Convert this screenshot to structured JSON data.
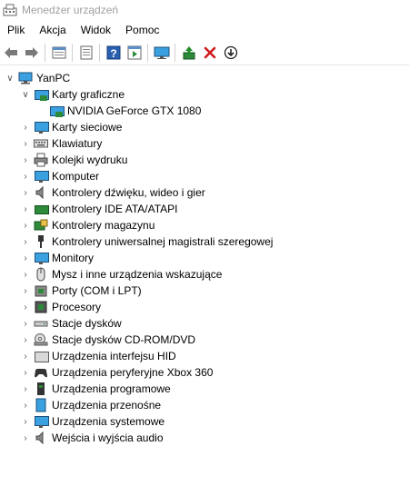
{
  "window": {
    "title": "Menedżer urządzeń"
  },
  "menu": {
    "items": [
      "Plik",
      "Akcja",
      "Widok",
      "Pomoc"
    ]
  },
  "toolbar": {
    "buttons": [
      "back-icon",
      "forward-icon",
      "properties-view-icon",
      "list-view-icon",
      "help-icon",
      "run-icon",
      "monitor-scan-icon",
      "update-driver-icon",
      "uninstall-icon",
      "disable-device-icon"
    ]
  },
  "tree": {
    "root": "YanPC",
    "categories": [
      {
        "label": "Karty graficzne",
        "icon": "display-adapter-icon",
        "expanded": true,
        "children": [
          "NVIDIA GeForce GTX 1080"
        ]
      },
      {
        "label": "Karty sieciowe",
        "icon": "network-adapter-icon"
      },
      {
        "label": "Klawiatury",
        "icon": "keyboard-icon"
      },
      {
        "label": "Kolejki wydruku",
        "icon": "printer-icon"
      },
      {
        "label": "Komputer",
        "icon": "computer-icon"
      },
      {
        "label": "Kontrolery dźwięku, wideo i gier",
        "icon": "speaker-icon"
      },
      {
        "label": "Kontrolery IDE ATA/ATAPI",
        "icon": "ide-controller-icon"
      },
      {
        "label": "Kontrolery magazynu",
        "icon": "storage-controller-icon"
      },
      {
        "label": "Kontrolery uniwersalnej magistrali szeregowej",
        "icon": "usb-icon"
      },
      {
        "label": "Monitory",
        "icon": "monitor-icon"
      },
      {
        "label": "Mysz i inne urządzenia wskazujące",
        "icon": "mouse-icon"
      },
      {
        "label": "Porty (COM i LPT)",
        "icon": "port-icon"
      },
      {
        "label": "Procesory",
        "icon": "processor-icon"
      },
      {
        "label": "Stacje dysków",
        "icon": "disk-drive-icon"
      },
      {
        "label": "Stacje dysków CD-ROM/DVD",
        "icon": "cd-rom-icon"
      },
      {
        "label": "Urządzenia interfejsu HID",
        "icon": "hid-icon"
      },
      {
        "label": "Urządzenia peryferyjne Xbox 360",
        "icon": "gamepad-icon"
      },
      {
        "label": "Urządzenia programowe",
        "icon": "software-device-icon"
      },
      {
        "label": "Urządzenia przenośne",
        "icon": "portable-device-icon"
      },
      {
        "label": "Urządzenia systemowe",
        "icon": "system-device-icon"
      },
      {
        "label": "Wejścia i wyjścia audio",
        "icon": "audio-io-icon"
      }
    ]
  }
}
